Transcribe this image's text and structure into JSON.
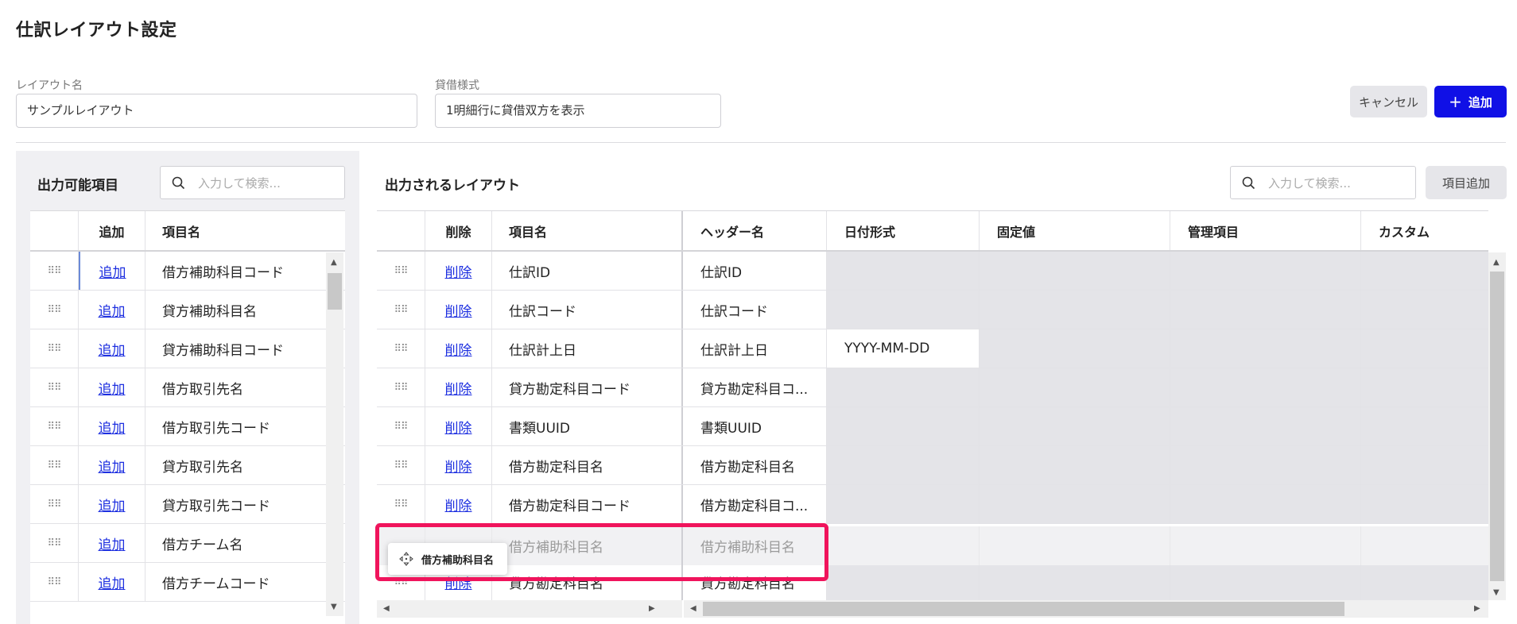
{
  "page": {
    "title": "仕訳レイアウト設定"
  },
  "form": {
    "layout_name_label": "レイアウト名",
    "layout_name_value": "サンプルレイアウト",
    "debit_credit_label": "貸借様式",
    "debit_credit_value": "1明細行に貸借双方を表示"
  },
  "header_buttons": {
    "cancel": "キャンセル",
    "add": "追加",
    "add_icon": "+"
  },
  "available": {
    "title": "出力可能項目",
    "search_placeholder": "入力して検索...",
    "columns": [
      "追加",
      "項目名"
    ],
    "rows": [
      {
        "action": "追加",
        "name": "借方補助科目コード"
      },
      {
        "action": "追加",
        "name": "貸方補助科目名"
      },
      {
        "action": "追加",
        "name": "貸方補助科目コード"
      },
      {
        "action": "追加",
        "name": "借方取引先名"
      },
      {
        "action": "追加",
        "name": "借方取引先コード"
      },
      {
        "action": "追加",
        "name": "貸方取引先名"
      },
      {
        "action": "追加",
        "name": "貸方取引先コード"
      },
      {
        "action": "追加",
        "name": "借方チーム名"
      },
      {
        "action": "追加",
        "name": "借方チームコード"
      }
    ]
  },
  "output": {
    "title": "出力されるレイアウト",
    "search_placeholder": "入力して検索...",
    "add_item_button": "項目追加",
    "columns": [
      "削除",
      "項目名",
      "ヘッダー名",
      "日付形式",
      "固定値",
      "管理項目",
      "カスタム"
    ],
    "rows": [
      {
        "action": "削除",
        "name": "仕訳ID",
        "header": "仕訳ID",
        "date_format": ""
      },
      {
        "action": "削除",
        "name": "仕訳コード",
        "header": "仕訳コード",
        "date_format": ""
      },
      {
        "action": "削除",
        "name": "仕訳計上日",
        "header": "仕訳計上日",
        "date_format": "YYYY-MM-DD"
      },
      {
        "action": "削除",
        "name": "貸方勘定科目コード",
        "header": "貸方勘定科目コ...",
        "date_format": ""
      },
      {
        "action": "削除",
        "name": "書類UUID",
        "header": "書類UUID",
        "date_format": ""
      },
      {
        "action": "削除",
        "name": "借方勘定科目名",
        "header": "借方勘定科目名",
        "date_format": ""
      },
      {
        "action": "削除",
        "name": "借方勘定科目コード",
        "header": "借方勘定科目コ...",
        "date_format": ""
      },
      {
        "action": "削除",
        "name": "貸方勘定科目名",
        "header": "貸方勘定科目名",
        "date_format": ""
      }
    ],
    "ghost_row": {
      "name": "借方補助科目名",
      "header": "借方補助科目名"
    },
    "drag_chip": "借方補助科目名"
  },
  "colors": {
    "primary": "#1010e6",
    "highlight": "#f0145c",
    "link": "#1d2fe0"
  }
}
